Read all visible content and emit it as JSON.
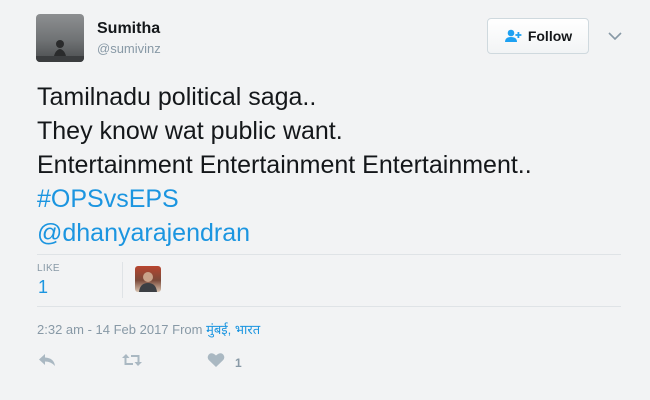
{
  "user": {
    "display_name": "Sumitha",
    "screen_name": "@sumivinz"
  },
  "follow_button": {
    "label": "Follow"
  },
  "tweet": {
    "lines": [
      "Tamilnadu political saga..",
      "They know wat public want.",
      "Entertainment Entertainment Entertainment.."
    ],
    "hashtag": "#OPSvsEPS",
    "mention": "@dhanyarajendran"
  },
  "stats": {
    "likes_label": "LIKE",
    "likes_count": "1"
  },
  "timestamp": {
    "time": "2:32 am - 14 Feb 2017 From ",
    "location": "मुंबई, भारत"
  },
  "actions": {
    "like_count": "1"
  },
  "icons": {
    "follow": "add-user-icon",
    "caret": "chevron-down-icon",
    "reply": "reply-icon",
    "retweet": "retweet-icon",
    "like": "heart-icon"
  },
  "colors": {
    "link": "#1b95e0",
    "muted": "#8899a6",
    "follow_icon": "#1da1f2"
  }
}
